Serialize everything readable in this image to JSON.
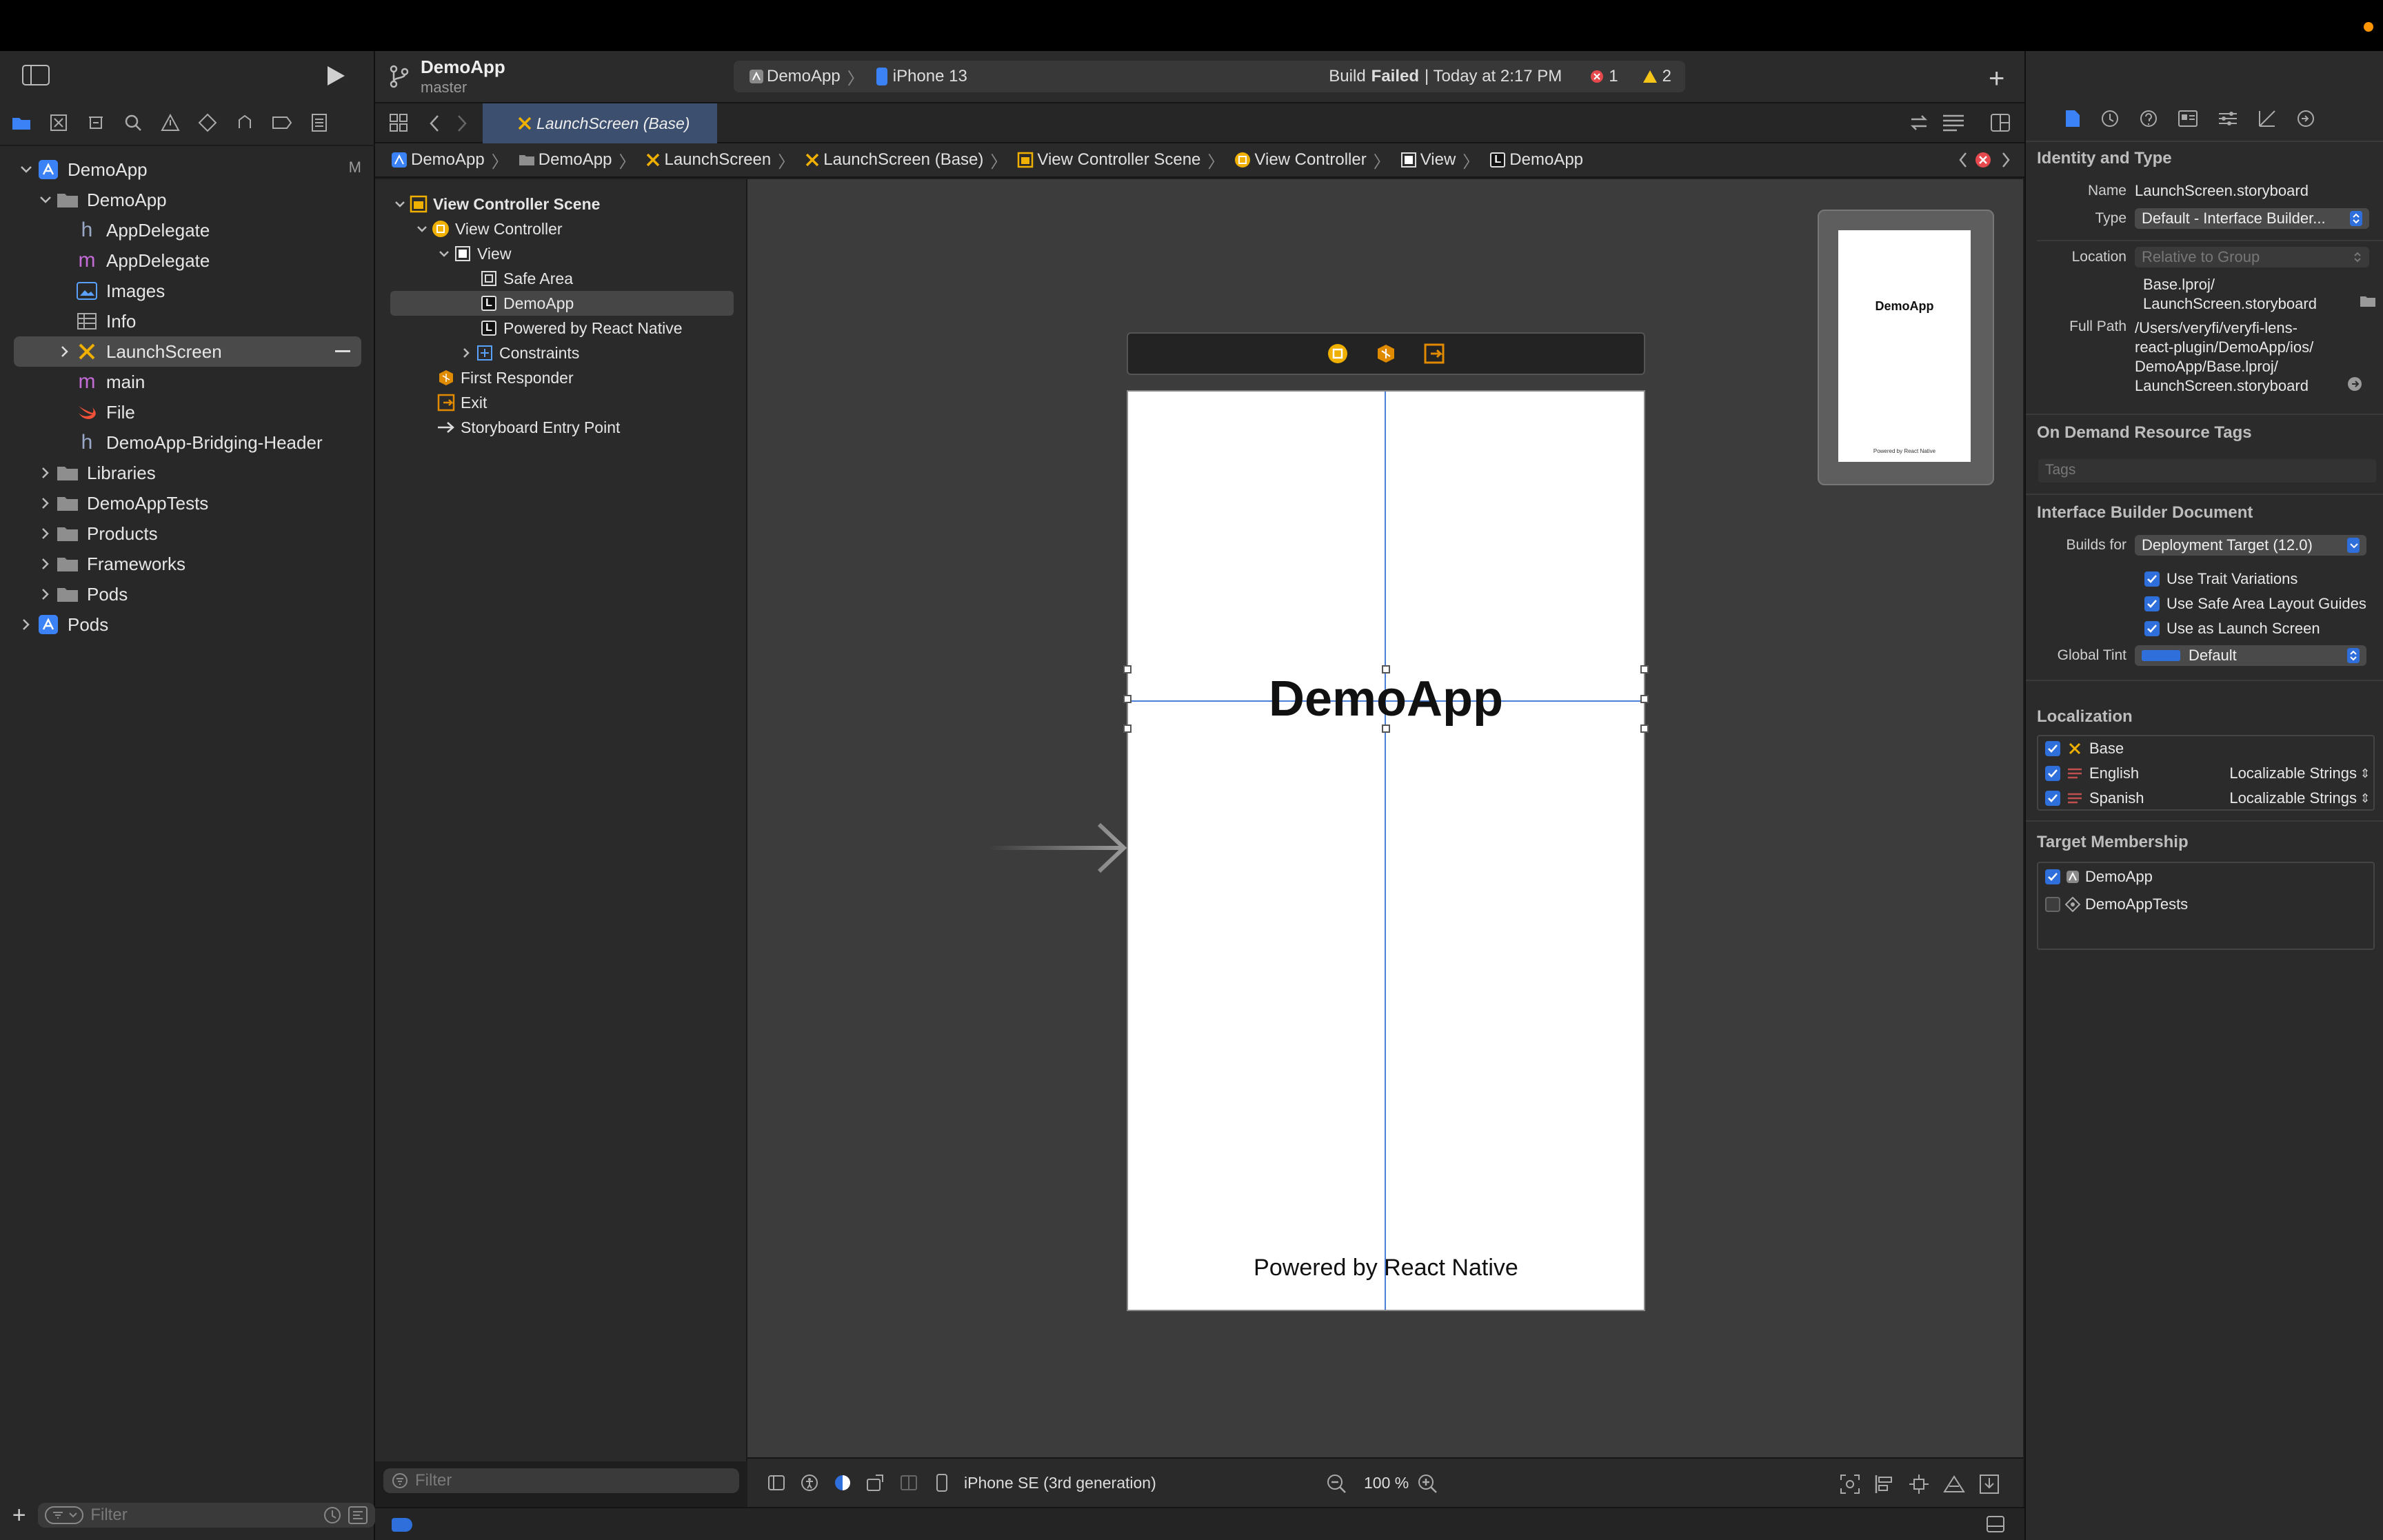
{
  "toolbar": {
    "project_name": "DemoApp",
    "branch": "master",
    "scheme_target": "DemoApp",
    "device": "iPhone 13",
    "status_prefix": "Build",
    "status_bold": "Failed",
    "status_time": "| Today at 2:17 PM",
    "error_count": "1",
    "warning_count": "2"
  },
  "tab": {
    "label": "LaunchScreen (Base)"
  },
  "jumpbar": [
    "DemoApp",
    "DemoApp",
    "LaunchScreen",
    "LaunchScreen (Base)",
    "View Controller Scene",
    "View Controller",
    "View",
    "DemoApp"
  ],
  "navigator": {
    "items": [
      {
        "label": "DemoApp",
        "badge": "M"
      },
      {
        "label": "DemoApp"
      },
      {
        "label": "AppDelegate",
        "letter": "h"
      },
      {
        "label": "AppDelegate",
        "letter": "m"
      },
      {
        "label": "Images"
      },
      {
        "label": "Info"
      },
      {
        "label": "LaunchScreen"
      },
      {
        "label": "main",
        "letter": "m"
      },
      {
        "label": "File"
      },
      {
        "label": "DemoApp-Bridging-Header",
        "letter": "h"
      },
      {
        "label": "Libraries"
      },
      {
        "label": "DemoAppTests"
      },
      {
        "label": "Products"
      },
      {
        "label": "Frameworks"
      },
      {
        "label": "Pods"
      },
      {
        "label": "Pods"
      }
    ],
    "filter_placeholder": "Filter"
  },
  "outline": {
    "items": [
      "View Controller Scene",
      "View Controller",
      "View",
      "Safe Area",
      "DemoApp",
      "Powered by React Native",
      "Constraints",
      "First Responder",
      "Exit",
      "Storyboard Entry Point"
    ],
    "filter_placeholder": "Filter"
  },
  "canvas": {
    "title_label": "DemoApp",
    "footer_label": "Powered by React Native",
    "mini_title": "DemoApp",
    "mini_footer": "Powered by React Native",
    "device_config": "iPhone SE (3rd generation)",
    "zoom": "100 %"
  },
  "inspector": {
    "identity_title": "Identity and Type",
    "name_label": "Name",
    "name_value": "LaunchScreen.storyboard",
    "type_label": "Type",
    "type_value": "Default - Interface Builder...",
    "location_label": "Location",
    "location_value": "Relative to Group",
    "location_path_1": "Base.lproj/",
    "location_path_2": "LaunchScreen.storyboard",
    "fullpath_label": "Full Path",
    "fullpath_lines": [
      "/Users/veryfi/veryfi-lens-",
      "react-plugin/DemoApp/ios/",
      "DemoApp/Base.lproj/",
      "LaunchScreen.storyboard"
    ],
    "odr_title": "On Demand Resource Tags",
    "tags_placeholder": "Tags",
    "ibdoc_title": "Interface Builder Document",
    "builds_for_label": "Builds for",
    "builds_for_value": "Deployment Target (12.0)",
    "options": [
      "Use Trait Variations",
      "Use Safe Area Layout Guides",
      "Use as Launch Screen"
    ],
    "global_tint_label": "Global Tint",
    "global_tint_value": "Default",
    "localization_title": "Localization",
    "localizations": [
      {
        "name": "Base",
        "kind": ""
      },
      {
        "name": "English",
        "kind": "Localizable Strings"
      },
      {
        "name": "Spanish",
        "kind": "Localizable Strings"
      }
    ],
    "membership_title": "Target Membership",
    "targets": [
      {
        "name": "DemoApp",
        "checked": true
      },
      {
        "name": "DemoAppTests",
        "checked": false
      }
    ]
  },
  "colors": {
    "accent": "#2f6fdc",
    "error": "#e5484d",
    "warning": "#f5c518",
    "storyboard_yellow": "#f0b000"
  }
}
